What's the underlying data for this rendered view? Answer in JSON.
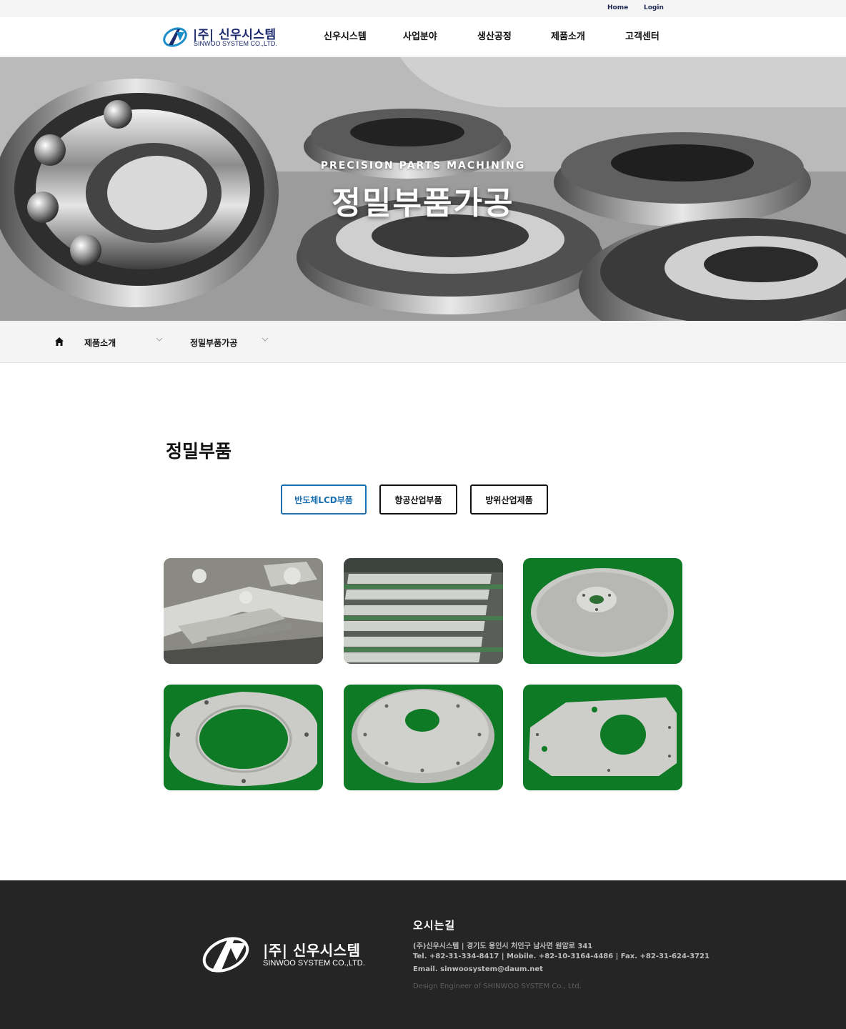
{
  "topbar": {
    "home": "Home",
    "login": "Login"
  },
  "header": {
    "logo_ko": "|주| 신우시스템",
    "logo_en": "SINWOO SYSTEM CO.,LTD.",
    "nav": [
      "신우시스템",
      "사업분야",
      "생산공정",
      "제품소개",
      "고객센터"
    ]
  },
  "hero": {
    "subtitle": "PRECISION PARTS MACHINING",
    "title": "정밀부품가공"
  },
  "breadcrumb": {
    "level1": "제품소개",
    "level2": "정밀부품가공"
  },
  "content": {
    "title": "정밀부품",
    "tabs": [
      {
        "label": "반도체LCD부품",
        "active": true
      },
      {
        "label": "항공산업부품",
        "active": false
      },
      {
        "label": "방위산업제품",
        "active": false
      }
    ]
  },
  "footer": {
    "logo_ko": "|주| 신우시스템",
    "logo_en": "SINWOO SYSTEM CO.,LTD.",
    "title": "오시는길",
    "line1": "(주)신우시스템   |   경기도 용인시 처인구 남사면 원암로 341",
    "line2": "Tel. +82-31-334-8417   |   Mobile. +82-10-3164-4486   |   Fax. +82-31-624-3721",
    "line3": "Email. sinwoosystem@daum.net",
    "copyright": "Design Engineer of SHINWOO SYSTEM Co., Ltd."
  },
  "colors": {
    "accent": "#1a6fb0",
    "brand": "#1a2a6c",
    "footer_bg": "#262526",
    "green_bg": "#0f7a25"
  }
}
